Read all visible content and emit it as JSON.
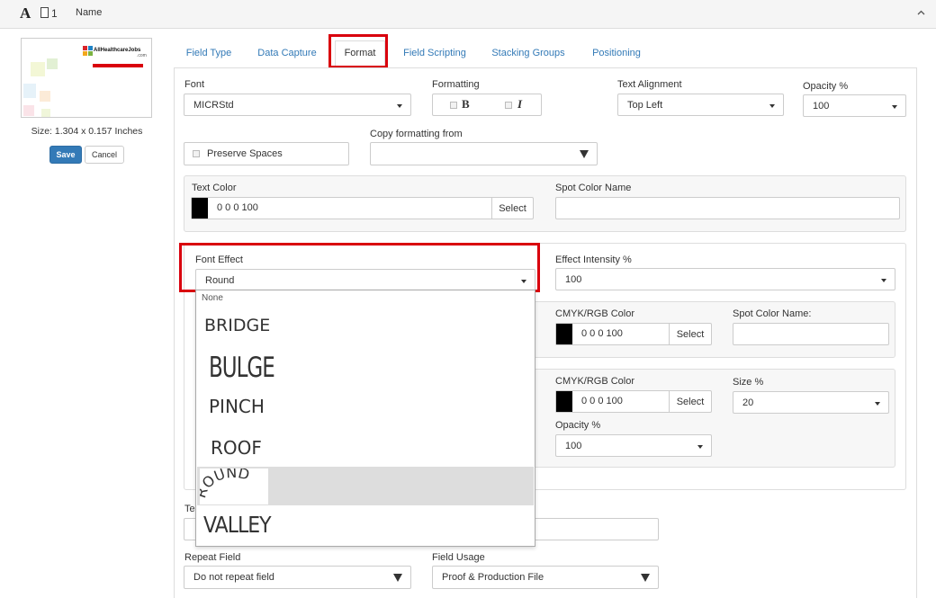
{
  "header": {
    "title": "Name",
    "badge": "1",
    "text_icon": "A"
  },
  "preview": {
    "logo_text": "AllHealthcareJobs",
    "logo_sub": ".com",
    "size_label": "Size: 1.304 x 0.157 Inches",
    "save_label": "Save",
    "cancel_label": "Cancel"
  },
  "tabs": [
    {
      "label": "Field Type"
    },
    {
      "label": "Data Capture"
    },
    {
      "label": "Format",
      "active": true
    },
    {
      "label": "Field Scripting"
    },
    {
      "label": "Stacking Groups"
    },
    {
      "label": "Positioning"
    }
  ],
  "format": {
    "font_label": "Font",
    "font_value": "MICRStd",
    "formatting_label": "Formatting",
    "bold": "B",
    "italic": "I",
    "alignment_label": "Text Alignment",
    "alignment_value": "Top Left",
    "opacity_label": "Opacity %",
    "opacity_value": "100",
    "preserve_spaces": "Preserve Spaces",
    "copy_from_label": "Copy formatting from",
    "copy_from_value": ""
  },
  "text_color": {
    "label": "Text Color",
    "value": "0 0 0 100",
    "select": "Select",
    "spot_label": "Spot Color Name",
    "spot_value": ""
  },
  "font_effect": {
    "label": "Font Effect",
    "value": "Round",
    "intensity_label": "Effect Intensity %",
    "intensity_value": "100",
    "options": [
      "None",
      "BRIDGE",
      "BULGE",
      "PINCH",
      "ROOF",
      "ROUND",
      "VALLEY"
    ],
    "selected_index": 5
  },
  "effect_color": {
    "label": "CMYK/RGB Color",
    "value": "0 0 0 100",
    "select": "Select",
    "spot_label": "Spot Color Name:",
    "spot_value": ""
  },
  "outline": {
    "label": "CMYK/RGB Color",
    "value": "0 0 0 100",
    "select": "Select",
    "size_label": "Size %",
    "size_value": "20",
    "opacity_label": "Opacity %",
    "opacity_value": "100"
  },
  "lower": {
    "partial_label": "Te",
    "repeat_label": "Repeat Field",
    "repeat_value": "Do not repeat field",
    "usage_label": "Field Usage",
    "usage_value": "Proof & Production File"
  },
  "colors": {
    "highlight": "#d9000d",
    "link": "#337ab7",
    "primary": "#337ab7"
  }
}
